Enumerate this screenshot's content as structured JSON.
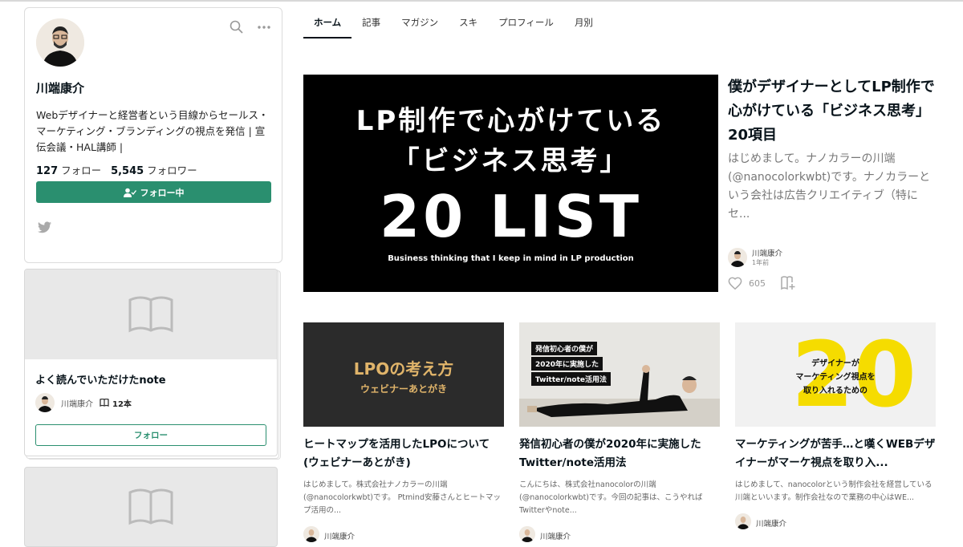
{
  "profile": {
    "name": "川端康介",
    "bio": "Webデザイナーと経営者という目線からセールス・マーケティング・ブランディングの視点を発信 | 宣伝会議・HAL講師 |",
    "follow_count": "127",
    "follow_label": "フォロー",
    "follower_count": "5,545",
    "follower_label": "フォロワー",
    "follow_button_label": "フォロー中"
  },
  "magazine": {
    "title": "よく読んでいただけたnote",
    "author": "川端康介",
    "count": "12本",
    "follow_label": "フォロー"
  },
  "tabs": [
    {
      "label": "ホーム",
      "active": true
    },
    {
      "label": "記事"
    },
    {
      "label": "マガジン"
    },
    {
      "label": "スキ"
    },
    {
      "label": "プロフィール"
    },
    {
      "label": "月別"
    }
  ],
  "featured": {
    "cover_line1": "LP制作で心がけている",
    "cover_line2": "「ビジネス思考」",
    "cover_line3": "20 LIST",
    "cover_line4": "Business thinking that I keep in mind in LP production",
    "title": "僕がデザイナーとしてLP制作で心がけている「ビジネス思考」20項目",
    "excerpt": "はじめまして。ナノカラーの川端(@nanocolorkwbt)です。ナノカラーという会社は広告クリエイティブ（特にセ...",
    "author": "川端康介",
    "date": "1年前",
    "likes": "605"
  },
  "articles": [
    {
      "cover_title": "LPOの考え方",
      "cover_sub": "ウェビナーあとがき",
      "title": "ヒートマップを活用したLPOについて(ウェビナーあとがき)",
      "excerpt": "はじめまして。株式会社ナノカラーの川端(@nanocolorkwbt)です。 Ptmind安藤さんとヒートマップ活用の...",
      "author": "川端康介"
    },
    {
      "cover_lines": [
        "発信初心者の僕が",
        "2020年に実施した",
        "Twitter/note活用法"
      ],
      "title": "発信初心者の僕が2020年に実施したTwitter/note活用法",
      "excerpt": "こんにちは、株式会社nanocolorの川端(@nanocolorkwbt)です。今回の記事は、こうやればTwitterやnote...",
      "author": "川端康介"
    },
    {
      "cover_number": "20",
      "cover_lines": [
        "デザイナーが",
        "マーケティング視点を",
        "取り入れるための"
      ],
      "title": "マーケティングが苦手…と嘆くWEBデザイナーがマーケ視点を取り入...",
      "excerpt": "はじめまして、nanocolorという制作会社を経営している川端といいます。制作会社なので業務の中心はWE...",
      "author": "川端康介"
    }
  ],
  "colors": {
    "accent": "#2a8f6f",
    "lpo_gold": "#e0b46a",
    "yellow": "#f5dc00"
  }
}
